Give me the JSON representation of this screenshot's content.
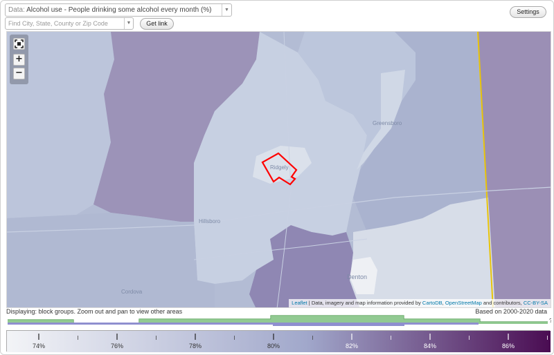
{
  "controls": {
    "data_prefix": "Data:",
    "data_value": "Alcohol use - People drinking some alcohol every month (%)",
    "find_placeholder": "Find City, State, County or Zip Code",
    "get_link_label": "Get link",
    "settings_label": "Settings"
  },
  "map": {
    "labels": {
      "greensboro": "Greensboro",
      "ridgely": "Ridgely",
      "hillsboro": "Hillsboro",
      "denton": "Denton",
      "cordova": "Cordova"
    },
    "zoom_in": "+",
    "zoom_out": "−",
    "attribution": {
      "leaflet": "Leaflet",
      "text_1": " | Data, imagery and map information provided by ",
      "cartodb": "CartoDB",
      "text_2": ", ",
      "osm": "OpenStreetMap",
      "text_3": " and contributors, ",
      "license": "CC-BY-SA"
    },
    "colors": {
      "low": "#dde3ec",
      "mid": "#aab5d2",
      "high": "#8a7aa8",
      "selected_outline": "#ff0000",
      "state_line": "#e8c40a"
    }
  },
  "status": {
    "displaying": "Displaying: block groups. Zoom out and pan to view other areas",
    "based_on": "Based on 2000-2020 data"
  },
  "legend": {
    "tick_labels": [
      "74%",
      "76%",
      "78%",
      "80%",
      "82%",
      "84%",
      "86%"
    ],
    "question_mark": "?",
    "colors": {
      "start": "#f3f4f7",
      "middle": "#a1a8cb",
      "end": "#4a0c52"
    }
  }
}
